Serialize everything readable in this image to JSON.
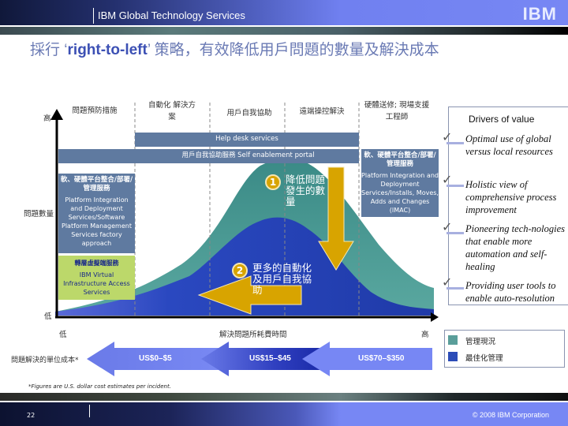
{
  "header": {
    "division": "IBM Global Technology Services",
    "logo": "IBM"
  },
  "title": {
    "prefix": "採行 ‘",
    "highlight": "right-to-left",
    "suffix": "’ 策略，有效降低用戶問題的數量及解決成本"
  },
  "axes": {
    "y_high": "高",
    "y_label": "問題數量",
    "y_low": "低",
    "x_low": "低",
    "x_label": "解決問題所耗費時間",
    "x_high": "高"
  },
  "columns": [
    {
      "label": "問題預防措施"
    },
    {
      "label": "自動化 解決方案"
    },
    {
      "label": "用戶自我協助"
    },
    {
      "label": "遠端操控解決"
    },
    {
      "label": "硬體送修; 現場支援工程師"
    }
  ],
  "bands": {
    "help_desk": "Help desk services",
    "self_enablement": "用戶自我協助服務 Self enablement portal"
  },
  "left_box": {
    "cn": "軟、硬體平台整合/部署/管理服務",
    "en": "Platform Integration and Deployment Services/Software Platform Management Services factory approach"
  },
  "green_box": {
    "cn": "轉層虛擬端服務",
    "en": "IBM Virtual Infrastructure Access Services"
  },
  "right_box": {
    "cn": "軟、硬體平台整合/部署/管理服務",
    "en": "Platform Integration and Deployment Services/Installs, Moves, Adds and Changes (IMAC)"
  },
  "callouts": [
    {
      "num": "1",
      "text": "降低問題發生的數量"
    },
    {
      "num": "2",
      "text": "更多的自動化及用戶自我協助"
    }
  ],
  "drivers": {
    "title": "Drivers of value",
    "items": [
      "Optimal use of global versus local resources",
      "Holistic view of comprehensive process improvement",
      "Pioneering tech-nologies that enable more automation and self-healing",
      "Providing user tools to enable auto-resolution"
    ]
  },
  "legend": [
    {
      "label": "管理現況",
      "color": "#5a9e9a"
    },
    {
      "label": "最佳化管理",
      "color": "#2c4cb8"
    }
  ],
  "cost": {
    "label": "問題解決的單位成本*",
    "tiers": [
      "US$0–$5",
      "US$15–$45",
      "US$70–$350"
    ]
  },
  "footnote": "*Figures are U.S. dollar cost estimates per incident.",
  "footer": {
    "page": "22",
    "copyright": "© 2008 IBM Corporation"
  },
  "colors": {
    "teal_curve": "#4f9a94",
    "blue_curve": "#2c4cb8",
    "arrow_gold": "#d8a400",
    "band_slate": "#5f7aa0"
  }
}
